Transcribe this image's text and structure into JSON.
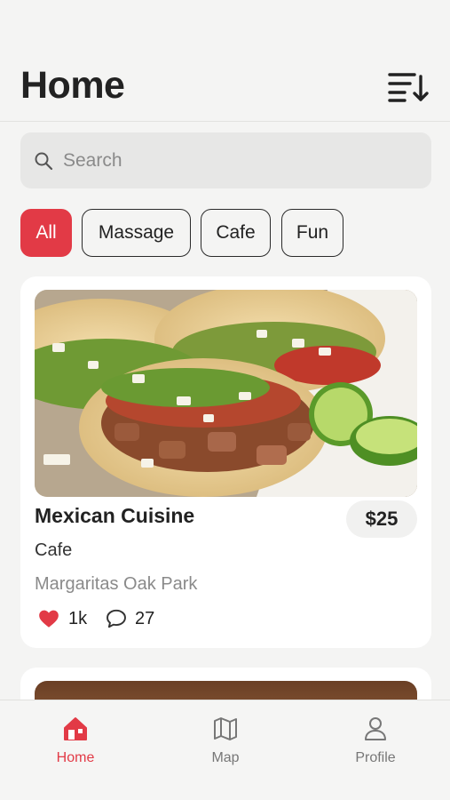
{
  "header": {
    "title": "Home",
    "sort_icon": "sort-descending-icon"
  },
  "search": {
    "placeholder": "Search",
    "value": "",
    "icon": "search-icon"
  },
  "filters": {
    "chips": [
      {
        "label": "All",
        "selected": true
      },
      {
        "label": "Massage",
        "selected": false
      },
      {
        "label": "Cafe",
        "selected": false
      },
      {
        "label": "Fun",
        "selected": false
      }
    ]
  },
  "listings": [
    {
      "photo": "tacos-photo",
      "title": "Mexican Cuisine",
      "price": "$25",
      "category": "Cafe",
      "location": "Margaritas Oak Park",
      "likes": "1k",
      "comments": "27",
      "liked": true
    }
  ],
  "tabbar": {
    "tabs": [
      {
        "label": "Home",
        "icon": "home-icon",
        "active": true
      },
      {
        "label": "Map",
        "icon": "map-icon",
        "active": false
      },
      {
        "label": "Profile",
        "icon": "profile-icon",
        "active": false
      }
    ]
  },
  "colors": {
    "accent": "#e23a46",
    "background": "#f4f4f3",
    "card": "#ffffff",
    "muted_text": "#8a8a8a"
  }
}
